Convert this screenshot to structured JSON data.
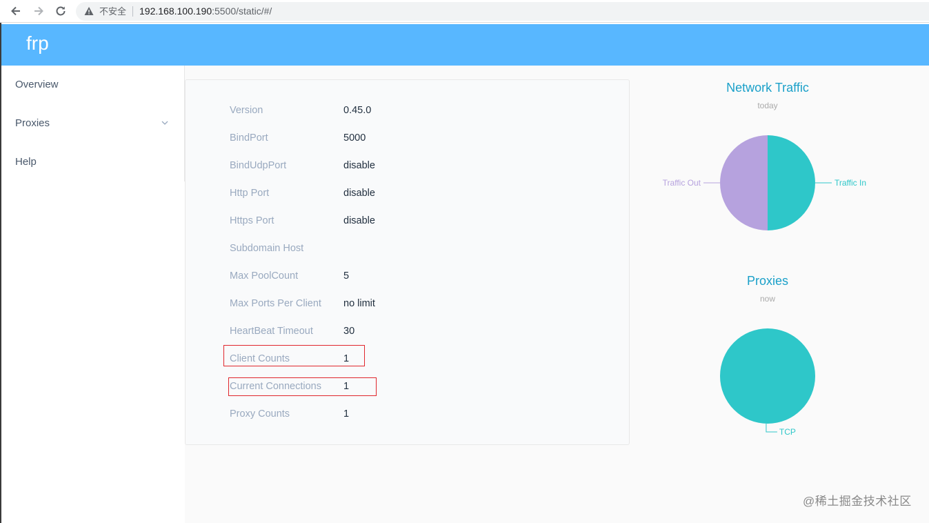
{
  "browser": {
    "back_icon": "arrow-left-icon",
    "forward_icon": "arrow-right-icon",
    "reload_icon": "reload-icon",
    "security_label": "不安全",
    "url_host": "192.168.100.190",
    "url_rest": ":5500/static/#/"
  },
  "header": {
    "brand": "frp"
  },
  "sidebar": {
    "items": [
      {
        "label": "Overview"
      },
      {
        "label": "Proxies",
        "icon": "chevron-down-icon"
      },
      {
        "label": "Help"
      }
    ]
  },
  "overview": {
    "rows": [
      {
        "key": "Version",
        "value": "0.45.0"
      },
      {
        "key": "BindPort",
        "value": "5000"
      },
      {
        "key": "BindUdpPort",
        "value": "disable"
      },
      {
        "key": "Http Port",
        "value": "disable"
      },
      {
        "key": "Https Port",
        "value": "disable"
      },
      {
        "key": "Subdomain Host",
        "value": ""
      },
      {
        "key": "Max PoolCount",
        "value": "5"
      },
      {
        "key": "Max Ports Per Client",
        "value": "no limit"
      },
      {
        "key": "HeartBeat Timeout",
        "value": "30"
      },
      {
        "key": "Client Counts",
        "value": "1"
      },
      {
        "key": "Current Connections",
        "value": "1"
      },
      {
        "key": "Proxy Counts",
        "value": "1"
      }
    ],
    "highlight_color": "#e0252b"
  },
  "chart_data": [
    {
      "type": "pie",
      "title": "Network Traffic",
      "subtitle": "today",
      "categories": [
        "Traffic In",
        "Traffic Out"
      ],
      "values": [
        50,
        50
      ],
      "colors": [
        "#2ec7c9",
        "#b6a2de"
      ]
    },
    {
      "type": "pie",
      "title": "Proxies",
      "subtitle": "now",
      "categories": [
        "TCP"
      ],
      "values": [
        1
      ],
      "colors": [
        "#2ec7c9"
      ]
    }
  ],
  "watermark": "@稀土掘金技术社区"
}
